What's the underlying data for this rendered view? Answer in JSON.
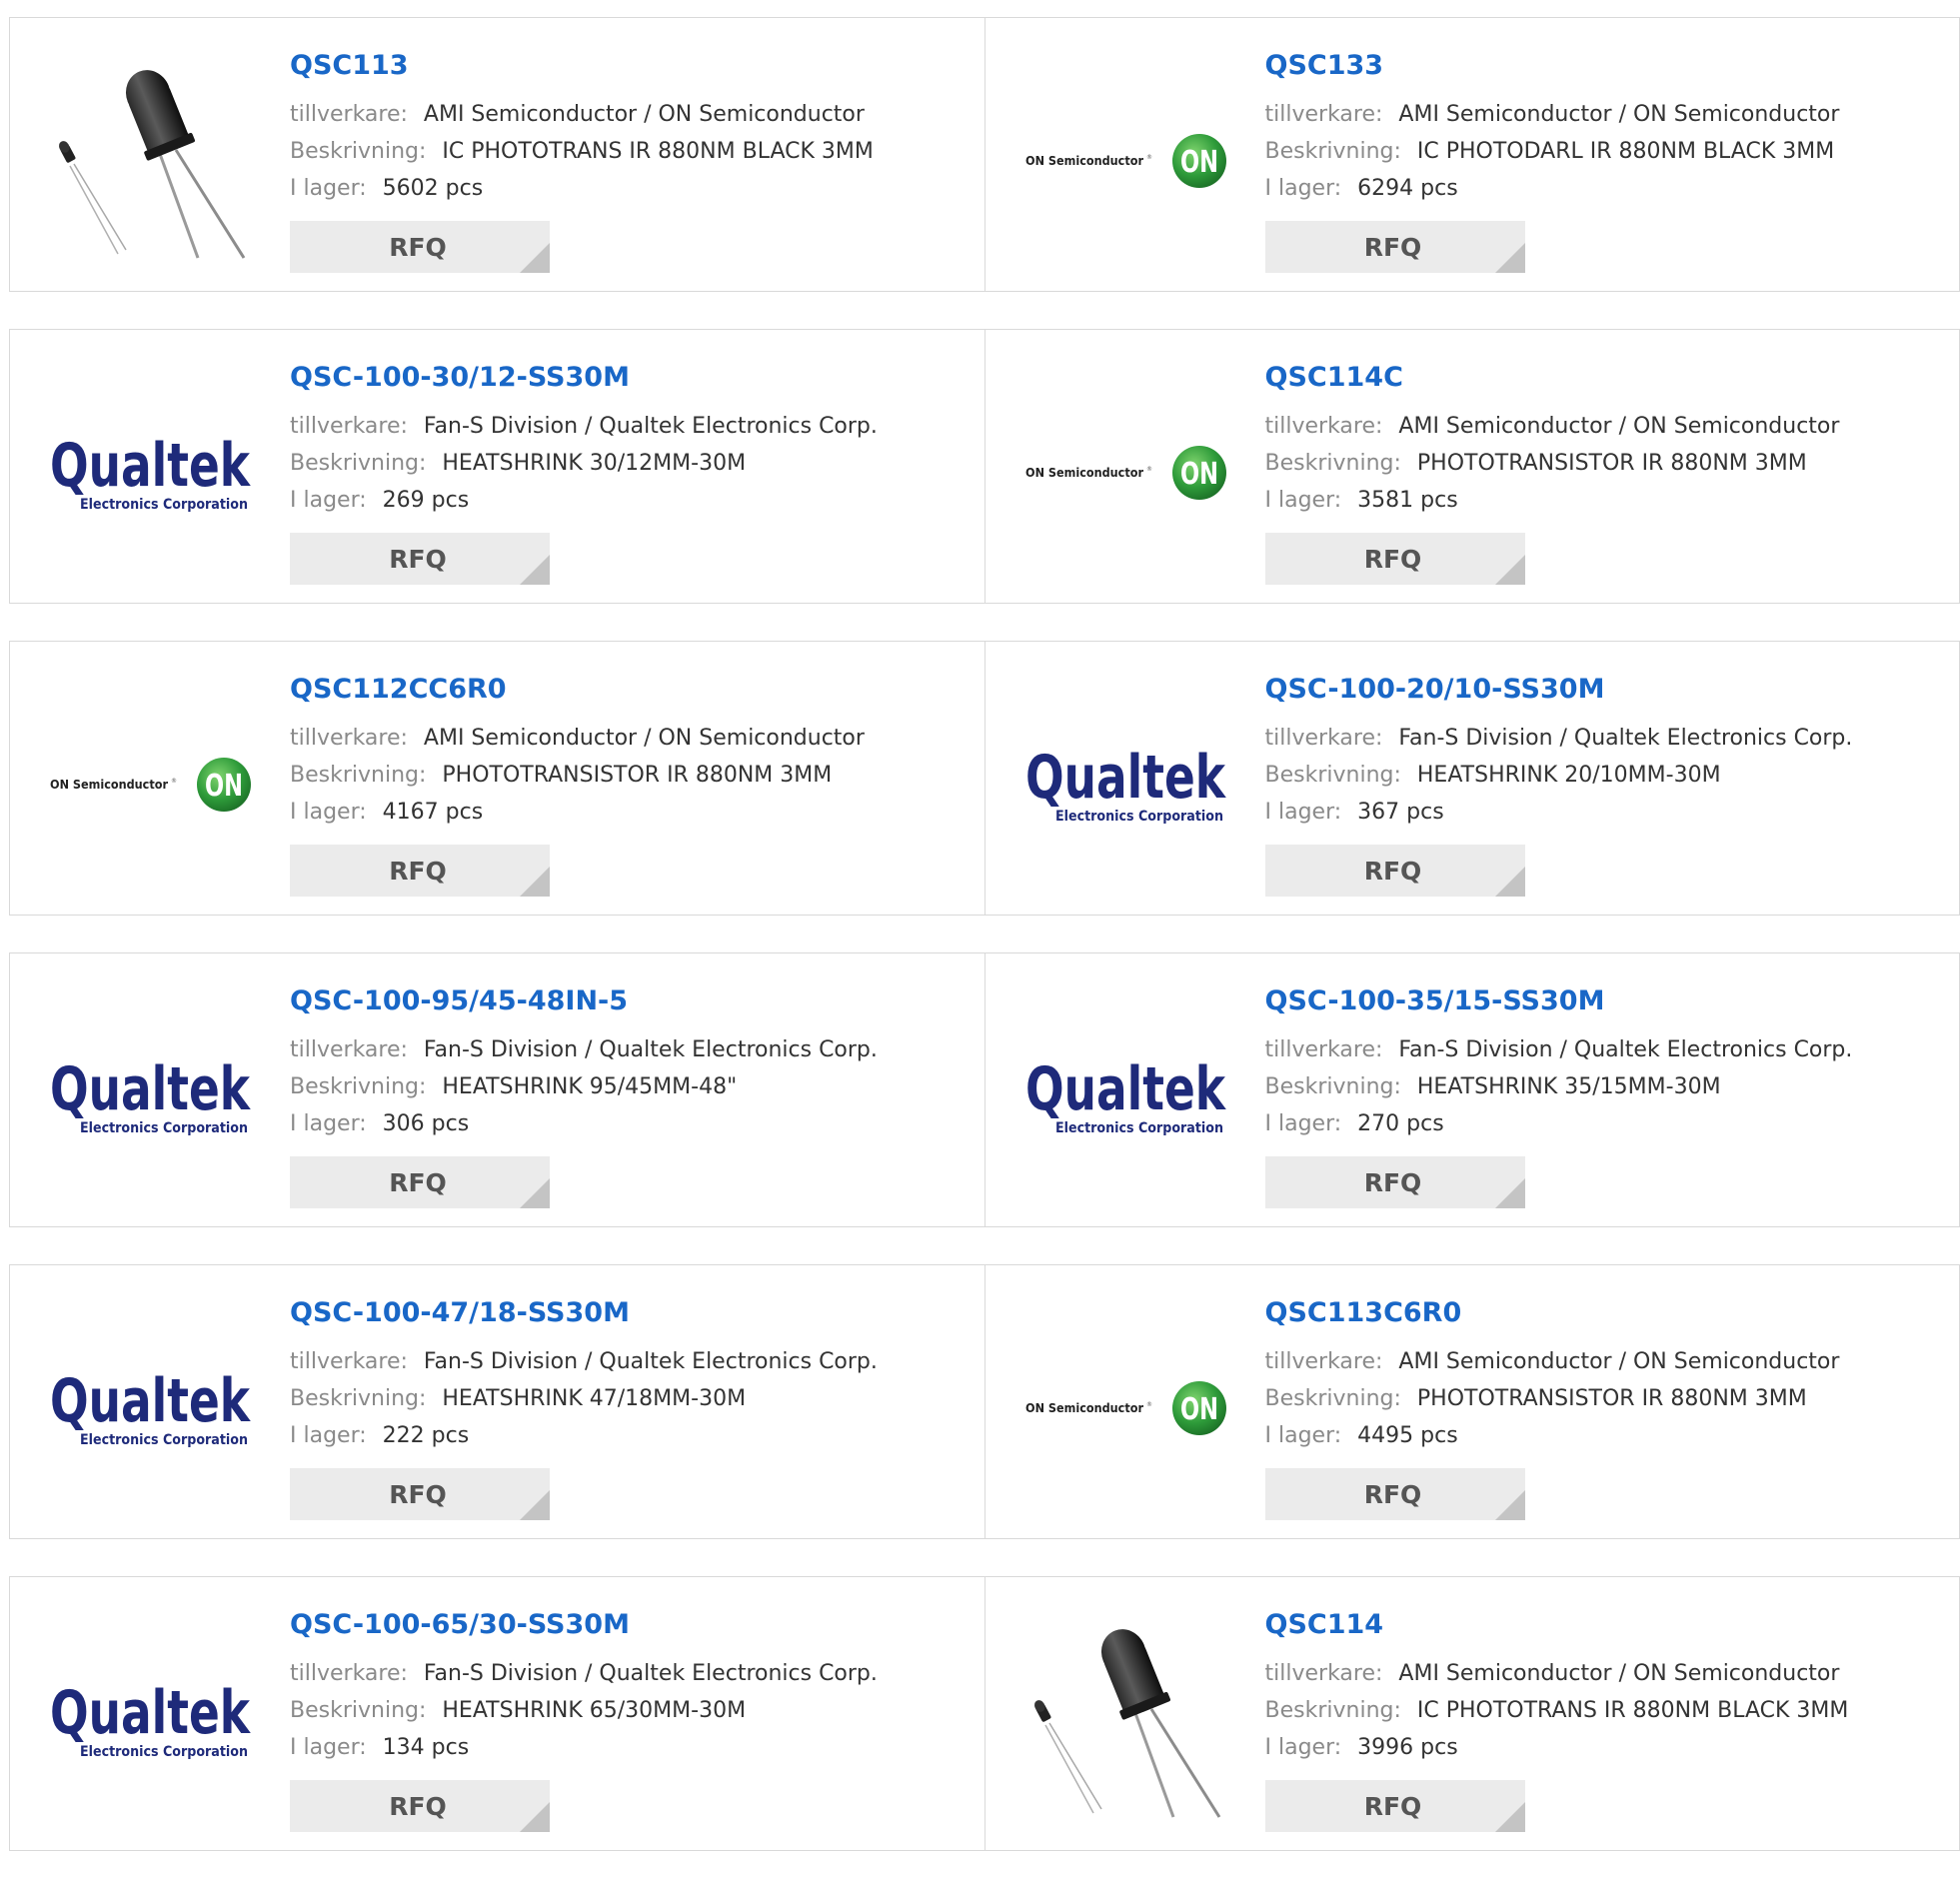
{
  "labels": {
    "manufacturer": "tillverkare:",
    "description": "Beskrivning:",
    "stock": "I lager:",
    "rfq": "RFQ"
  },
  "brand_colors": {
    "part_link": "#1967c7",
    "qualtek": "#1e2a7a",
    "on_green": "#2e9b3a"
  },
  "products": [
    {
      "pn": "QSC113",
      "manufacturer": "AMI Semiconductor / ON Semiconductor",
      "description": "IC PHOTOTRANS IR 880NM BLACK 3MM",
      "stock": "5602 pcs",
      "image": "phototransistor-photo"
    },
    {
      "pn": "QSC133",
      "manufacturer": "AMI Semiconductor / ON Semiconductor",
      "description": "IC PHOTODARL IR 880NM BLACK 3MM",
      "stock": "6294 pcs",
      "image": "on-semiconductor-logo"
    },
    {
      "pn": "QSC-100-30/12-SS30M",
      "manufacturer": "Fan-S Division / Qualtek Electronics Corp.",
      "description": "HEATSHRINK 30/12MM-30M",
      "stock": "269 pcs",
      "image": "qualtek-logo"
    },
    {
      "pn": "QSC114C",
      "manufacturer": "AMI Semiconductor / ON Semiconductor",
      "description": "PHOTOTRANSISTOR IR 880NM 3MM",
      "stock": "3581 pcs",
      "image": "on-semiconductor-logo"
    },
    {
      "pn": "QSC112CC6R0",
      "manufacturer": "AMI Semiconductor / ON Semiconductor",
      "description": "PHOTOTRANSISTOR IR 880NM 3MM",
      "stock": "4167 pcs",
      "image": "on-semiconductor-logo"
    },
    {
      "pn": "QSC-100-20/10-SS30M",
      "manufacturer": "Fan-S Division / Qualtek Electronics Corp.",
      "description": "HEATSHRINK 20/10MM-30M",
      "stock": "367 pcs",
      "image": "qualtek-logo"
    },
    {
      "pn": "QSC-100-95/45-48IN-5",
      "manufacturer": "Fan-S Division / Qualtek Electronics Corp.",
      "description": "HEATSHRINK 95/45MM-48\"",
      "stock": "306 pcs",
      "image": "qualtek-logo"
    },
    {
      "pn": "QSC-100-35/15-SS30M",
      "manufacturer": "Fan-S Division / Qualtek Electronics Corp.",
      "description": "HEATSHRINK 35/15MM-30M",
      "stock": "270 pcs",
      "image": "qualtek-logo"
    },
    {
      "pn": "QSC-100-47/18-SS30M",
      "manufacturer": "Fan-S Division / Qualtek Electronics Corp.",
      "description": "HEATSHRINK 47/18MM-30M",
      "stock": "222 pcs",
      "image": "qualtek-logo"
    },
    {
      "pn": "QSC113C6R0",
      "manufacturer": "AMI Semiconductor / ON Semiconductor",
      "description": "PHOTOTRANSISTOR IR 880NM 3MM",
      "stock": "4495 pcs",
      "image": "on-semiconductor-logo"
    },
    {
      "pn": "QSC-100-65/30-SS30M",
      "manufacturer": "Fan-S Division / Qualtek Electronics Corp.",
      "description": "HEATSHRINK 65/30MM-30M",
      "stock": "134 pcs",
      "image": "qualtek-logo"
    },
    {
      "pn": "QSC114",
      "manufacturer": "AMI Semiconductor / ON Semiconductor",
      "description": "IC PHOTOTRANS IR 880NM BLACK 3MM",
      "stock": "3996 pcs",
      "image": "phototransistor-photo"
    }
  ]
}
